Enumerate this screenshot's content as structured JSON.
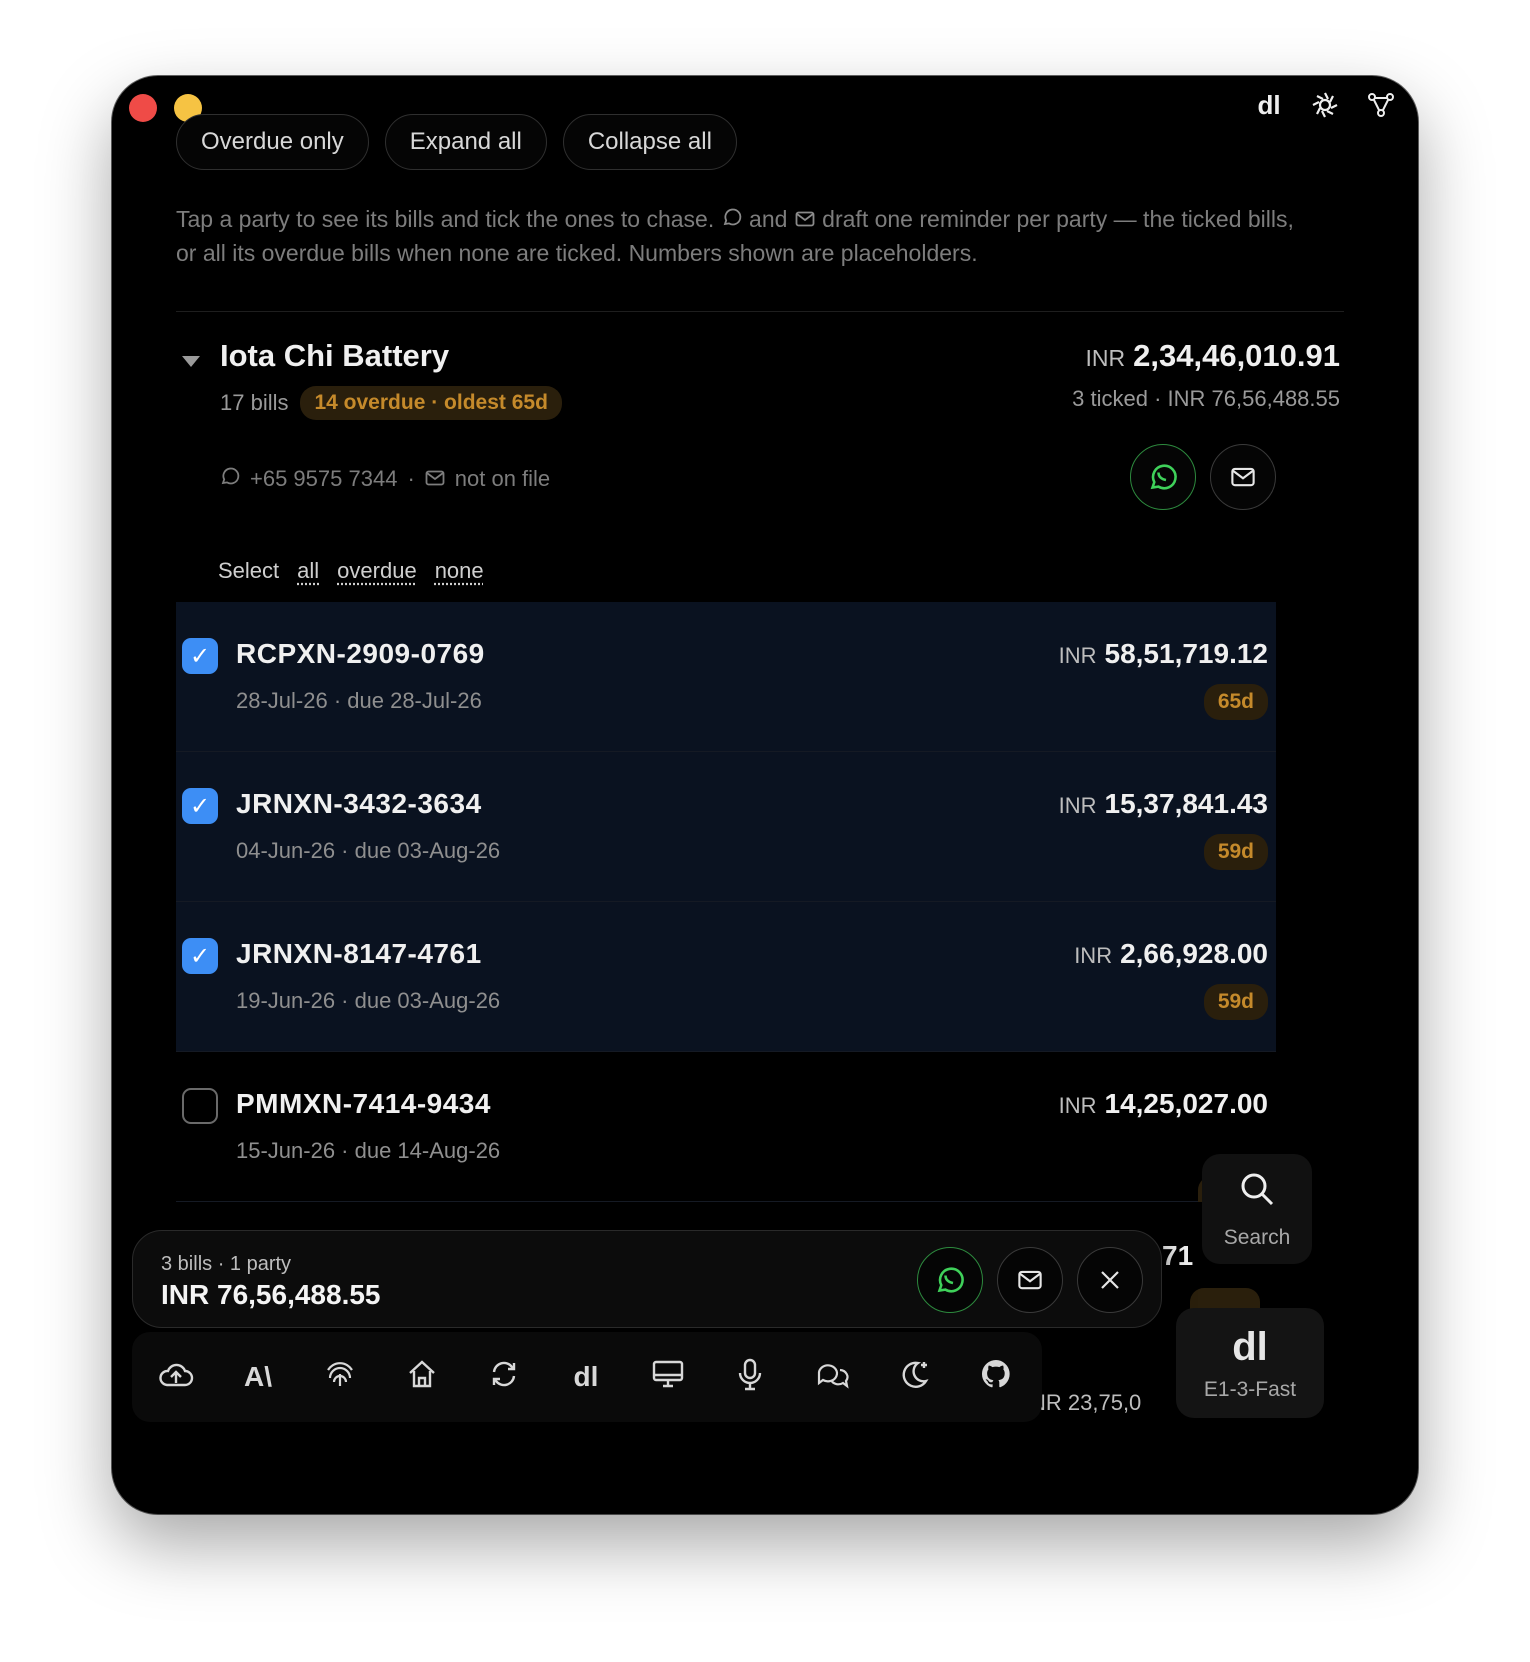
{
  "toolbar": {
    "chips": [
      "Overdue only",
      "Expand all",
      "Collapse all"
    ],
    "icons": [
      "dl-logo-icon",
      "openai-icon",
      "nodes-icon"
    ],
    "dl": "dl"
  },
  "hint": {
    "part1": "Tap a party to see its bills and tick the ones to chase. ",
    "and": " and ",
    "part2": " draft one reminder per party — the ticked bills, or all its overdue bills when none are ticked. Numbers shown are placeholders."
  },
  "party": {
    "name": "Iota Chi Battery",
    "bills": "17 bills",
    "overdue": "14 overdue · oldest 65d",
    "currency": "INR",
    "total": "2,34,46,010.91",
    "ticked": "3 ticked · INR 76,56,488.55",
    "phone": "+65 9575 7344",
    "sep": "·",
    "email": "not on file",
    "select_label": "Select",
    "select_all": "all",
    "select_overdue": "overdue",
    "select_none": "none"
  },
  "bills": [
    {
      "id": "RCPXN-2909-0769",
      "dates": "28-Jul-26 · due 28-Jul-26",
      "currency": "INR",
      "amount": "58,51,719.12",
      "age": "65d",
      "checked": true
    },
    {
      "id": "JRNXN-3432-3634",
      "dates": "04-Jun-26 · due 03-Aug-26",
      "currency": "INR",
      "amount": "15,37,841.43",
      "age": "59d",
      "checked": true
    },
    {
      "id": "JRNXN-8147-4761",
      "dates": "19-Jun-26 · due 03-Aug-26",
      "currency": "INR",
      "amount": "2,66,928.00",
      "age": "59d",
      "checked": true
    },
    {
      "id": "PMMXN-7414-9434",
      "dates": "15-Jun-26 · due 14-Aug-26",
      "currency": "INR",
      "amount": "14,25,027.00",
      "age": "",
      "checked": false
    }
  ],
  "partials": {
    "amount_a": "71",
    "amount_b": "NR 23,75,0"
  },
  "selection": {
    "count": "3 bills · 1 party",
    "total": "INR 76,56,488.55"
  },
  "dock": {
    "items": [
      "cloud-upload-icon",
      "anthropic-icon",
      "fingerprint-icon",
      "home-icon",
      "sync-icon",
      "dl-icon",
      "monitor-icon",
      "microphone-icon",
      "chat-icon",
      "moon-icon",
      "github-icon"
    ],
    "dl": "dl"
  },
  "search": {
    "label": "Search"
  },
  "model": {
    "icon": "dl",
    "label": "E1-3-Fast"
  },
  "colors": {
    "accent": "#3d8ef5",
    "whatsapp": "#3fd15a",
    "overdue": "#c58a2b"
  }
}
